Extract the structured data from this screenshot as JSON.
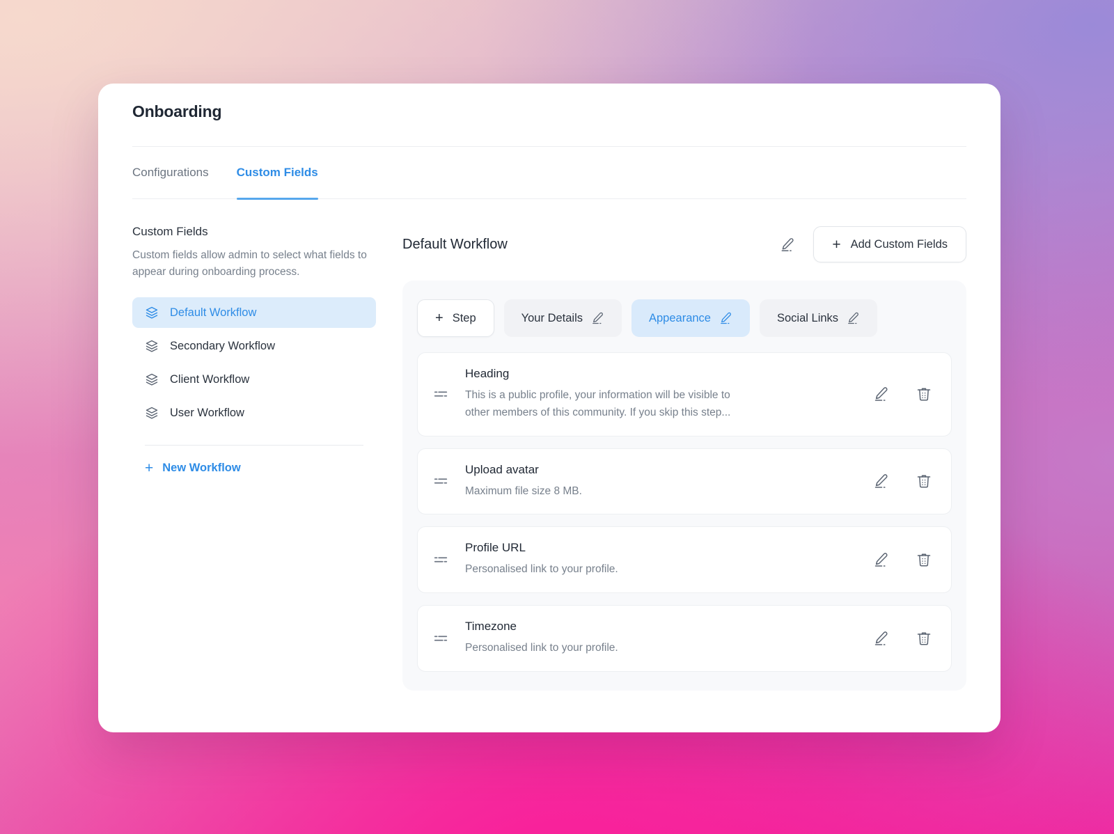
{
  "window": {
    "page_title": "Onboarding"
  },
  "tabs": [
    {
      "label": "Configurations",
      "active": false
    },
    {
      "label": "Custom Fields",
      "active": true
    }
  ],
  "left_panel": {
    "title": "Custom Fields",
    "description": "Custom fields allow admin to select what fields to appear during onboarding process.",
    "workflows": [
      {
        "label": "Default Workflow",
        "active": true
      },
      {
        "label": "Secondary Workflow",
        "active": false
      },
      {
        "label": "Client Workflow",
        "active": false
      },
      {
        "label": "User Workflow",
        "active": false
      }
    ],
    "new_workflow_label": "New Workflow",
    "new_workflow_plus": "+"
  },
  "right_panel": {
    "title": "Default Workflow",
    "edit_title_icon": "pencil-edit-icon",
    "add_button": {
      "plus": "+",
      "label": "Add Custom Fields"
    },
    "steps": [
      {
        "label": "Step",
        "type": "add",
        "plus": "+",
        "active": false,
        "has_edit_icon": false
      },
      {
        "label": "Your Details",
        "type": "step",
        "active": false,
        "has_edit_icon": true
      },
      {
        "label": "Appearance",
        "type": "step",
        "active": true,
        "has_edit_icon": true
      },
      {
        "label": "Social Links",
        "type": "step",
        "active": false,
        "has_edit_icon": true
      }
    ],
    "fields": [
      {
        "title": "Heading",
        "description": "This is a public profile, your information will be visible to other members of this community. If you skip this step...",
        "drag_icon": "drag-handle-icon",
        "edit_icon": "pencil-edit-icon",
        "delete_icon": "trash-icon"
      },
      {
        "title": "Upload avatar",
        "description": "Maximum file size 8 MB.",
        "drag_icon": "drag-handle-icon",
        "edit_icon": "pencil-edit-icon",
        "delete_icon": "trash-icon"
      },
      {
        "title": "Profile URL",
        "description": "Personalised link to your profile.",
        "drag_icon": "drag-handle-icon",
        "edit_icon": "pencil-edit-icon",
        "delete_icon": "trash-icon"
      },
      {
        "title": "Timezone",
        "description": "Personalised link to your profile.",
        "drag_icon": "drag-handle-icon",
        "edit_icon": "pencil-edit-icon",
        "delete_icon": "trash-icon"
      }
    ]
  },
  "colors": {
    "accent_blue": "#2e8ce6",
    "active_chip_bg": "#d9eafb",
    "sidebar_active_bg": "#dcecfb",
    "panel_bg": "#f8f9fb",
    "card_bg": "#ffffff",
    "text_primary": "#1f2733",
    "text_muted": "#77808c",
    "backdrop_pink": "#fb0f96",
    "backdrop_purple": "#9b8ad8",
    "backdrop_peach": "#f6d9cd"
  }
}
